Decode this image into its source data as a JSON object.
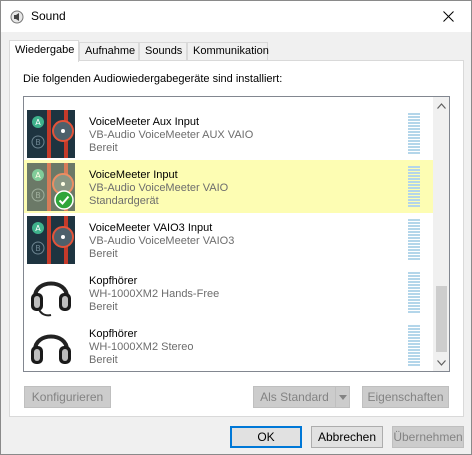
{
  "window": {
    "title": "Sound"
  },
  "tabs": [
    {
      "label": "Wiedergabe"
    },
    {
      "label": "Aufnahme"
    },
    {
      "label": "Sounds"
    },
    {
      "label": "Kommunikation"
    }
  ],
  "panel": {
    "heading": "Die folgenden Audiowiedergabegeräte sind installiert:"
  },
  "devices": [
    {
      "name": "VoiceMeeter Aux Input",
      "description": "VB-Audio VoiceMeeter AUX VAIO",
      "status": "Bereit",
      "icon": "voicemeeter-icon",
      "selected": false,
      "default": false
    },
    {
      "name": "VoiceMeeter Input",
      "description": "VB-Audio VoiceMeeter VAIO",
      "status": "Standardgerät",
      "icon": "voicemeeter-icon",
      "selected": true,
      "default": true
    },
    {
      "name": "VoiceMeeter VAIO3 Input",
      "description": "VB-Audio VoiceMeeter VAIO3",
      "status": "Bereit",
      "icon": "voicemeeter-icon",
      "selected": false,
      "default": false
    },
    {
      "name": "Kopfhörer",
      "description": "WH-1000XM2 Hands-Free",
      "status": "Bereit",
      "icon": "headset-icon",
      "selected": false,
      "default": false
    },
    {
      "name": "Kopfhörer",
      "description": "WH-1000XM2 Stereo",
      "status": "Bereit",
      "icon": "headphones-icon",
      "selected": false,
      "default": false
    }
  ],
  "buttons": {
    "configure": "Konfigurieren",
    "set_default": "Als Standard",
    "properties": "Eigenschaften",
    "ok": "OK",
    "cancel": "Abbrechen",
    "apply": "Übernehmen"
  },
  "colors": {
    "selection": "#fdfdb3",
    "accent": "#0078d7",
    "meter": "#b4d6ea",
    "voicemeeter_bg": "#1e3440",
    "voicemeeter_red": "#e2533a",
    "voicemeeter_green": "#3fb28c",
    "check_green": "#2fa53a"
  }
}
